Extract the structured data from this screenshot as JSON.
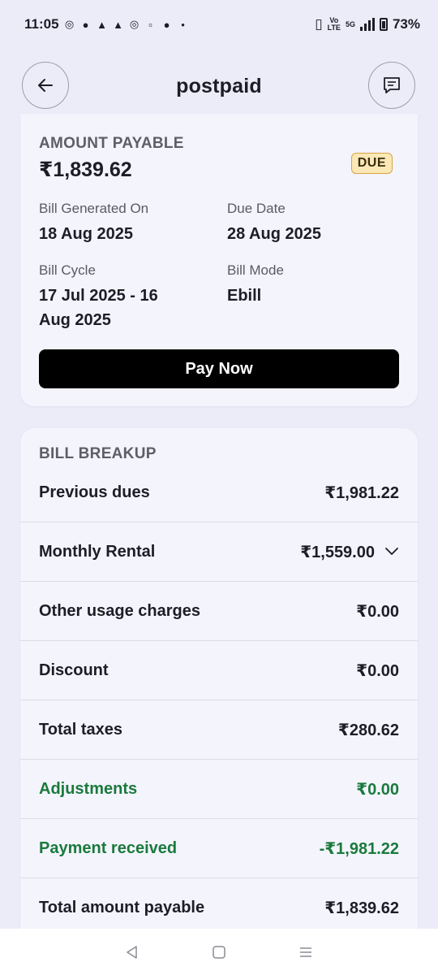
{
  "status_bar": {
    "time": "11:05",
    "battery": "73%",
    "volte_top": "Vo",
    "volte_bottom": "LTE",
    "net": "5G"
  },
  "header": {
    "title": "postpaid"
  },
  "summary": {
    "amount_label": "AMOUNT PAYABLE",
    "amount_value": "₹1,839.62",
    "status_badge": "DUE",
    "bill_generated_label": "Bill Generated On",
    "bill_generated_value": "18 Aug 2025",
    "due_date_label": "Due Date",
    "due_date_value": "28 Aug 2025",
    "bill_cycle_label": "Bill Cycle",
    "bill_cycle_line1": "17 Jul 2025 - 16",
    "bill_cycle_line2": "Aug 2025",
    "bill_mode_label": "Bill Mode",
    "bill_mode_value": "Ebill",
    "pay_button": "Pay Now"
  },
  "breakup": {
    "title": "BILL BREAKUP",
    "rows": [
      {
        "label": "Previous dues",
        "value": "₹1,981.22"
      },
      {
        "label": "Monthly Rental",
        "value": "₹1,559.00"
      },
      {
        "label": "Other usage charges",
        "value": "₹0.00"
      },
      {
        "label": "Discount",
        "value": "₹0.00"
      },
      {
        "label": "Total taxes",
        "value": "₹280.62"
      },
      {
        "label": "Adjustments",
        "value": "₹0.00"
      },
      {
        "label": "Payment received",
        "value": "-₹1,981.22"
      },
      {
        "label": "Total amount payable",
        "value": "₹1,839.62"
      }
    ]
  },
  "colors": {
    "background": "#ECECF9",
    "card": "#F4F4FD",
    "accent_green": "#1a7a3c",
    "due_badge_bg": "#FBE8B6",
    "pay_button_bg": "#000000"
  },
  "icons": {
    "back": "arrow-left-icon",
    "chat": "chat-bubble-icon",
    "expand": "chevron-down-icon",
    "nav_back": "triangle-back-icon",
    "nav_home": "square-home-icon",
    "nav_recents": "menu-lines-icon"
  }
}
